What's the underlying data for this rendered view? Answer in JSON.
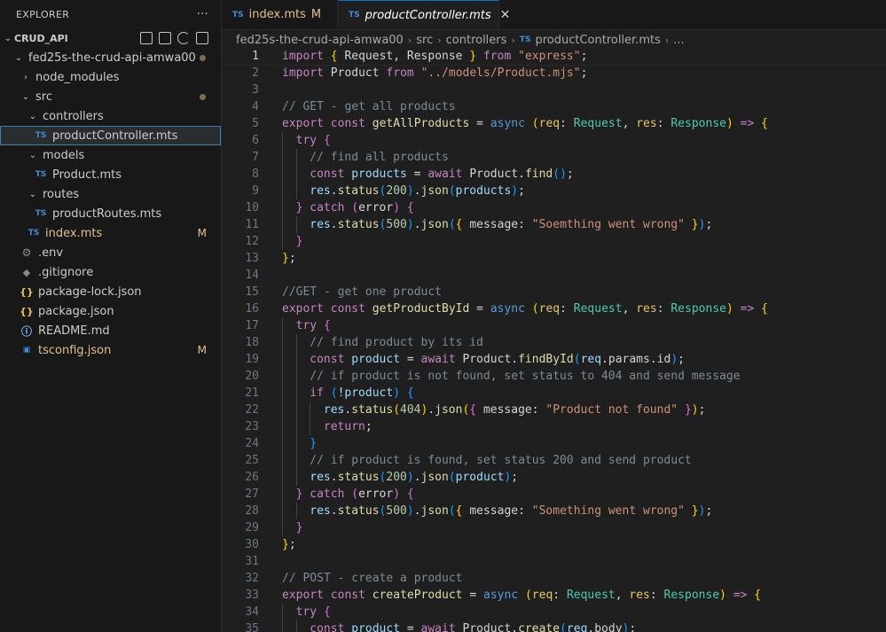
{
  "explorer": {
    "title": "EXPLORER",
    "more": "···",
    "root": "CRUD_API",
    "items": [
      {
        "label": "fed25s-the-crud-api-amwa00",
        "depth": 1,
        "kind": "folder-open",
        "dot": true
      },
      {
        "label": "node_modules",
        "depth": 2,
        "kind": "folder-closed"
      },
      {
        "label": "src",
        "depth": 2,
        "kind": "folder-open",
        "dot": true
      },
      {
        "label": "controllers",
        "depth": 3,
        "kind": "folder-open"
      },
      {
        "label": "productController.mts",
        "depth": 4,
        "kind": "ts",
        "selected": true
      },
      {
        "label": "models",
        "depth": 3,
        "kind": "folder-open"
      },
      {
        "label": "Product.mts",
        "depth": 4,
        "kind": "ts"
      },
      {
        "label": "routes",
        "depth": 3,
        "kind": "folder-open"
      },
      {
        "label": "productRoutes.mts",
        "depth": 4,
        "kind": "ts"
      },
      {
        "label": "index.mts",
        "depth": 3,
        "kind": "ts",
        "status": "M",
        "modified": true
      },
      {
        "label": ".env",
        "depth": 2,
        "kind": "gear"
      },
      {
        "label": ".gitignore",
        "depth": 2,
        "kind": "git"
      },
      {
        "label": "package-lock.json",
        "depth": 2,
        "kind": "json"
      },
      {
        "label": "package.json",
        "depth": 2,
        "kind": "json"
      },
      {
        "label": "README.md",
        "depth": 2,
        "kind": "info"
      },
      {
        "label": "tsconfig.json",
        "depth": 2,
        "kind": "tsconfig",
        "status": "M",
        "modified": true
      }
    ]
  },
  "tabs": [
    {
      "badge": "TS",
      "label": "index.mts",
      "status": "M",
      "active": false
    },
    {
      "badge": "TS",
      "label": "productController.mts",
      "close": "✕",
      "active": true
    }
  ],
  "breadcrumb": [
    "fed25s-the-crud-api-amwa00",
    "src",
    "controllers",
    "productController.mts",
    "..."
  ],
  "breadcrumb_badge": "TS",
  "editor": {
    "current_line": 1,
    "lines": [
      {
        "n": "1",
        "indent": 0,
        "t": [
          [
            "import ",
            "kw"
          ],
          [
            "{ ",
            "br1"
          ],
          [
            "Request, Response ",
            "id"
          ],
          [
            "} ",
            "br1"
          ],
          [
            "from ",
            "kw"
          ],
          [
            "\"express\"",
            "str"
          ],
          [
            ";",
            "p"
          ]
        ]
      },
      {
        "n": "2",
        "indent": 0,
        "t": [
          [
            "import ",
            "kw"
          ],
          [
            "Product ",
            "id"
          ],
          [
            "from ",
            "kw"
          ],
          [
            "\"../models/Product.mjs\"",
            "str"
          ],
          [
            ";",
            "p"
          ]
        ]
      },
      {
        "n": "3",
        "indent": 0,
        "t": []
      },
      {
        "n": "4",
        "indent": 0,
        "t": [
          [
            "// GET - get all products",
            "cm"
          ]
        ]
      },
      {
        "n": "5",
        "indent": 0,
        "t": [
          [
            "export ",
            "kw"
          ],
          [
            "const ",
            "kw"
          ],
          [
            "getAllProducts ",
            "fn"
          ],
          [
            "= ",
            "p"
          ],
          [
            "async ",
            "kw2"
          ],
          [
            "(",
            "br1"
          ],
          [
            "req",
            "par"
          ],
          [
            ": ",
            "p"
          ],
          [
            "Request",
            "ty"
          ],
          [
            ", ",
            "p"
          ],
          [
            "res",
            "par"
          ],
          [
            ": ",
            "p"
          ],
          [
            "Response",
            "ty"
          ],
          [
            ") ",
            "br1"
          ],
          [
            "=> ",
            "kw"
          ],
          [
            "{",
            "br1"
          ]
        ]
      },
      {
        "n": "6",
        "indent": 1,
        "t": [
          [
            "try ",
            "kw"
          ],
          [
            "{",
            "br2"
          ]
        ]
      },
      {
        "n": "7",
        "indent": 2,
        "t": [
          [
            "// find all products",
            "cm"
          ]
        ]
      },
      {
        "n": "8",
        "indent": 2,
        "t": [
          [
            "const ",
            "kw"
          ],
          [
            "products ",
            "var"
          ],
          [
            "= ",
            "p"
          ],
          [
            "await ",
            "kw"
          ],
          [
            "Product",
            "id"
          ],
          [
            ".",
            "p"
          ],
          [
            "find",
            "fn"
          ],
          [
            "()",
            "br3"
          ],
          [
            ";",
            "p"
          ]
        ]
      },
      {
        "n": "9",
        "indent": 2,
        "t": [
          [
            "res",
            "var"
          ],
          [
            ".",
            "p"
          ],
          [
            "status",
            "fn"
          ],
          [
            "(",
            "br3"
          ],
          [
            "200",
            "num"
          ],
          [
            ")",
            "br3"
          ],
          [
            ".",
            "p"
          ],
          [
            "json",
            "fn"
          ],
          [
            "(",
            "br3"
          ],
          [
            "products",
            "var"
          ],
          [
            ")",
            "br3"
          ],
          [
            ";",
            "p"
          ]
        ]
      },
      {
        "n": "10",
        "indent": 1,
        "t": [
          [
            "} ",
            "br2"
          ],
          [
            "catch ",
            "kw"
          ],
          [
            "(",
            "br2"
          ],
          [
            "error",
            "id"
          ],
          [
            ") ",
            "br2"
          ],
          [
            "{",
            "br2"
          ]
        ]
      },
      {
        "n": "11",
        "indent": 2,
        "t": [
          [
            "res",
            "var"
          ],
          [
            ".",
            "p"
          ],
          [
            "status",
            "fn"
          ],
          [
            "(",
            "br3"
          ],
          [
            "500",
            "num"
          ],
          [
            ")",
            "br3"
          ],
          [
            ".",
            "p"
          ],
          [
            "json",
            "fn"
          ],
          [
            "(",
            "br3"
          ],
          [
            "{ ",
            "br1"
          ],
          [
            "message",
            "id"
          ],
          [
            ": ",
            "p"
          ],
          [
            "\"Soemthing went wrong\"",
            "str"
          ],
          [
            " }",
            "br1"
          ],
          [
            ")",
            "br3"
          ],
          [
            ";",
            "p"
          ]
        ]
      },
      {
        "n": "12",
        "indent": 1,
        "t": [
          [
            "}",
            "br2"
          ]
        ]
      },
      {
        "n": "13",
        "indent": 0,
        "t": [
          [
            "}",
            "br1"
          ],
          [
            ";",
            "p"
          ]
        ]
      },
      {
        "n": "14",
        "indent": 0,
        "t": []
      },
      {
        "n": "15",
        "indent": 0,
        "t": [
          [
            "//GET - get one product",
            "cm"
          ]
        ]
      },
      {
        "n": "16",
        "indent": 0,
        "t": [
          [
            "export ",
            "kw"
          ],
          [
            "const ",
            "kw"
          ],
          [
            "getProductById ",
            "fn"
          ],
          [
            "= ",
            "p"
          ],
          [
            "async ",
            "kw2"
          ],
          [
            "(",
            "br1"
          ],
          [
            "req",
            "par"
          ],
          [
            ": ",
            "p"
          ],
          [
            "Request",
            "ty"
          ],
          [
            ", ",
            "p"
          ],
          [
            "res",
            "par"
          ],
          [
            ": ",
            "p"
          ],
          [
            "Response",
            "ty"
          ],
          [
            ") ",
            "br1"
          ],
          [
            "=> ",
            "kw"
          ],
          [
            "{",
            "br1"
          ]
        ]
      },
      {
        "n": "17",
        "indent": 1,
        "t": [
          [
            "try ",
            "kw"
          ],
          [
            "{",
            "br2"
          ]
        ]
      },
      {
        "n": "18",
        "indent": 2,
        "t": [
          [
            "// find product by its id",
            "cm"
          ]
        ]
      },
      {
        "n": "19",
        "indent": 2,
        "t": [
          [
            "const ",
            "kw"
          ],
          [
            "product ",
            "var"
          ],
          [
            "= ",
            "p"
          ],
          [
            "await ",
            "kw"
          ],
          [
            "Product",
            "id"
          ],
          [
            ".",
            "p"
          ],
          [
            "findById",
            "fn"
          ],
          [
            "(",
            "br3"
          ],
          [
            "req",
            "var"
          ],
          [
            ".",
            "p"
          ],
          [
            "params",
            "id"
          ],
          [
            ".",
            "p"
          ],
          [
            "id",
            "id"
          ],
          [
            ")",
            "br3"
          ],
          [
            ";",
            "p"
          ]
        ]
      },
      {
        "n": "20",
        "indent": 2,
        "t": [
          [
            "// if product is not found, set status to 404 and send message",
            "cm"
          ]
        ]
      },
      {
        "n": "21",
        "indent": 2,
        "t": [
          [
            "if ",
            "kw"
          ],
          [
            "(",
            "br3"
          ],
          [
            "!",
            "p"
          ],
          [
            "product",
            "var"
          ],
          [
            ") ",
            "br3"
          ],
          [
            "{",
            "br3"
          ]
        ]
      },
      {
        "n": "22",
        "indent": 3,
        "t": [
          [
            "res",
            "var"
          ],
          [
            ".",
            "p"
          ],
          [
            "status",
            "fn"
          ],
          [
            "(",
            "br1"
          ],
          [
            "404",
            "num"
          ],
          [
            ")",
            "br1"
          ],
          [
            ".",
            "p"
          ],
          [
            "json",
            "fn"
          ],
          [
            "(",
            "br1"
          ],
          [
            "{ ",
            "br2"
          ],
          [
            "message",
            "id"
          ],
          [
            ": ",
            "p"
          ],
          [
            "\"Product not found\"",
            "str"
          ],
          [
            " }",
            "br2"
          ],
          [
            ")",
            "br1"
          ],
          [
            ";",
            "p"
          ]
        ]
      },
      {
        "n": "23",
        "indent": 3,
        "t": [
          [
            "return",
            "kw"
          ],
          [
            ";",
            "p"
          ]
        ]
      },
      {
        "n": "24",
        "indent": 2,
        "t": [
          [
            "}",
            "br3"
          ]
        ]
      },
      {
        "n": "25",
        "indent": 2,
        "t": [
          [
            "// if product is found, set status 200 and send product",
            "cm"
          ]
        ]
      },
      {
        "n": "26",
        "indent": 2,
        "t": [
          [
            "res",
            "var"
          ],
          [
            ".",
            "p"
          ],
          [
            "status",
            "fn"
          ],
          [
            "(",
            "br3"
          ],
          [
            "200",
            "num"
          ],
          [
            ")",
            "br3"
          ],
          [
            ".",
            "p"
          ],
          [
            "json",
            "fn"
          ],
          [
            "(",
            "br3"
          ],
          [
            "product",
            "var"
          ],
          [
            ")",
            "br3"
          ],
          [
            ";",
            "p"
          ]
        ]
      },
      {
        "n": "27",
        "indent": 1,
        "t": [
          [
            "} ",
            "br2"
          ],
          [
            "catch ",
            "kw"
          ],
          [
            "(",
            "br2"
          ],
          [
            "error",
            "id"
          ],
          [
            ") ",
            "br2"
          ],
          [
            "{",
            "br2"
          ]
        ]
      },
      {
        "n": "28",
        "indent": 2,
        "t": [
          [
            "res",
            "var"
          ],
          [
            ".",
            "p"
          ],
          [
            "status",
            "fn"
          ],
          [
            "(",
            "br3"
          ],
          [
            "500",
            "num"
          ],
          [
            ")",
            "br3"
          ],
          [
            ".",
            "p"
          ],
          [
            "json",
            "fn"
          ],
          [
            "(",
            "br3"
          ],
          [
            "{ ",
            "br1"
          ],
          [
            "message",
            "id"
          ],
          [
            ": ",
            "p"
          ],
          [
            "\"Something went wrong\"",
            "str"
          ],
          [
            " }",
            "br1"
          ],
          [
            ")",
            "br3"
          ],
          [
            ";",
            "p"
          ]
        ]
      },
      {
        "n": "29",
        "indent": 1,
        "t": [
          [
            "}",
            "br2"
          ]
        ]
      },
      {
        "n": "30",
        "indent": 0,
        "t": [
          [
            "}",
            "br1"
          ],
          [
            ";",
            "p"
          ]
        ]
      },
      {
        "n": "31",
        "indent": 0,
        "t": []
      },
      {
        "n": "32",
        "indent": 0,
        "t": [
          [
            "// POST - create a product",
            "cm"
          ]
        ]
      },
      {
        "n": "33",
        "indent": 0,
        "t": [
          [
            "export ",
            "kw"
          ],
          [
            "const ",
            "kw"
          ],
          [
            "createProduct ",
            "fn"
          ],
          [
            "= ",
            "p"
          ],
          [
            "async ",
            "kw2"
          ],
          [
            "(",
            "br1"
          ],
          [
            "req",
            "par"
          ],
          [
            ": ",
            "p"
          ],
          [
            "Request",
            "ty"
          ],
          [
            ", ",
            "p"
          ],
          [
            "res",
            "par"
          ],
          [
            ": ",
            "p"
          ],
          [
            "Response",
            "ty"
          ],
          [
            ") ",
            "br1"
          ],
          [
            "=> ",
            "kw"
          ],
          [
            "{",
            "br1"
          ]
        ]
      },
      {
        "n": "34",
        "indent": 1,
        "t": [
          [
            "try ",
            "kw"
          ],
          [
            "{",
            "br2"
          ]
        ]
      },
      {
        "n": "35",
        "indent": 2,
        "t": [
          [
            "const ",
            "kw"
          ],
          [
            "product ",
            "var"
          ],
          [
            "= ",
            "p"
          ],
          [
            "await ",
            "kw"
          ],
          [
            "Product",
            "id"
          ],
          [
            ".",
            "p"
          ],
          [
            "create",
            "fn"
          ],
          [
            "(",
            "br3"
          ],
          [
            "req",
            "var"
          ],
          [
            ".",
            "p"
          ],
          [
            "body",
            "id"
          ],
          [
            ")",
            "br3"
          ],
          [
            ";",
            "p"
          ]
        ]
      }
    ]
  },
  "colors": {
    "kw": "#c586c0",
    "kw2": "#569cd6",
    "str": "#ce9178",
    "cm": "#7c8b96",
    "fn": "#dcdcaa",
    "var": "#9cdcfe",
    "par": "#e8c56b",
    "ty": "#4ec9b0",
    "num": "#b5cea8",
    "id": "#d4d4d4",
    "p": "#d4d4d4",
    "br1": "#ffd700",
    "br2": "#da70d6",
    "br3": "#179fff"
  }
}
